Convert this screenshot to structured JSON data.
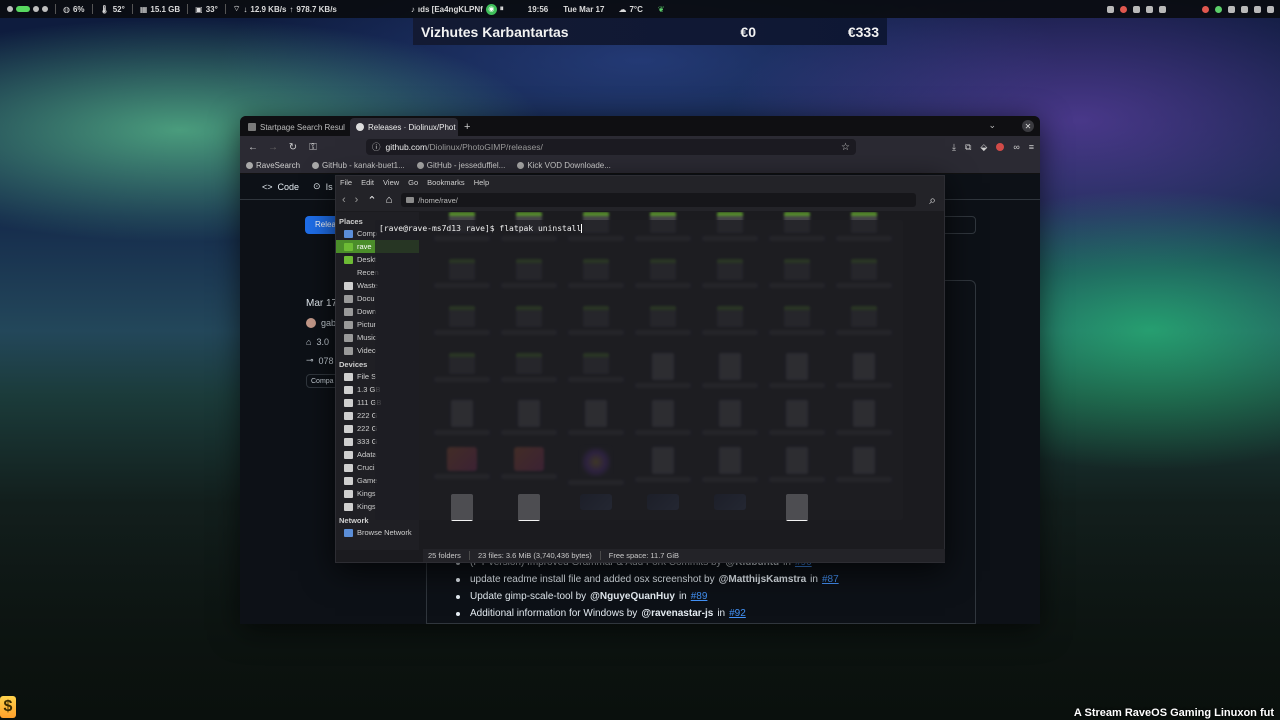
{
  "top_panel": {
    "cpu": "6%",
    "temp_cpu": "52°",
    "mem": "15.1 GB",
    "temp_gpu": "33°",
    "net_down": "12.9 KB/s",
    "net_up": "978.7 KB/s",
    "now_playing": "ıds [Ea4ngKLPNf",
    "time": "19:56",
    "date": "Tue Mar 17",
    "weather": "7°C"
  },
  "overlay": {
    "name": "Vizhutes Karbantartas",
    "value1": "€0",
    "value2": "€333"
  },
  "watermark": "A Stream RaveOS Gaming Linuxon fut",
  "browser": {
    "tabs": [
      {
        "label": "Startpage Search Resul"
      },
      {
        "label": "Releases · Diolinux/Phot"
      }
    ],
    "url_host": "github.com",
    "url_path": "/Diolinux/PhotoGIMP/releases/",
    "bookmarks": [
      "RaveSearch",
      "GitHub - kanak-buet1...",
      "GitHub - jesseduffiel...",
      "Kick VOD Downloade..."
    ],
    "repo_tabs": [
      "Code",
      "Is"
    ],
    "releases_btn": "Relea",
    "side": {
      "date": "Mar 17",
      "author": "gab",
      "tag": "3.0",
      "commit": "078",
      "compare": "Compa"
    },
    "changes": [
      {
        "text": "(PT version) Improved Grammar & Add Fork Commits by",
        "user": "@Kidbuntu",
        "in": "in",
        "pr": "#90"
      },
      {
        "text": "update readme install file and added osx screenshot by",
        "user": "@MatthijsKamstra",
        "in": "in",
        "pr": "#87"
      },
      {
        "text": "Update gimp-scale-tool by",
        "user": "@NguyeQuanHuy",
        "in": "in",
        "pr": "#89"
      },
      {
        "text": "Additional information for Windows by",
        "user": "@ravenastar-js",
        "in": "in",
        "pr": "#92"
      }
    ]
  },
  "file_manager": {
    "menu": [
      "File",
      "Edit",
      "View",
      "Go",
      "Bookmarks",
      "Help"
    ],
    "path": "/home/rave/",
    "places_header": "Places",
    "places": [
      "Comp",
      "rave",
      "Deskt",
      "Recen",
      "Waste",
      "Docu",
      "Down",
      "Pictur",
      "Music",
      "Video"
    ],
    "devices_header": "Devices",
    "devices": [
      "File S",
      "1.3 GB",
      "111 GB",
      "222 G",
      "222 G",
      "333 G",
      "Adata",
      "Cruci",
      "Game",
      "Kings",
      "Kings"
    ],
    "network_header": "Network",
    "network": [
      "Browse Network"
    ],
    "status": [
      "25 folders",
      "23 files: 3.6 MiB (3,740,436 bytes)",
      "Free space: 11.7 GiB"
    ]
  },
  "terminal": {
    "prompt": "[rave@rave-ms7d13 rave]$ ",
    "command": "flatpak uninstall"
  }
}
